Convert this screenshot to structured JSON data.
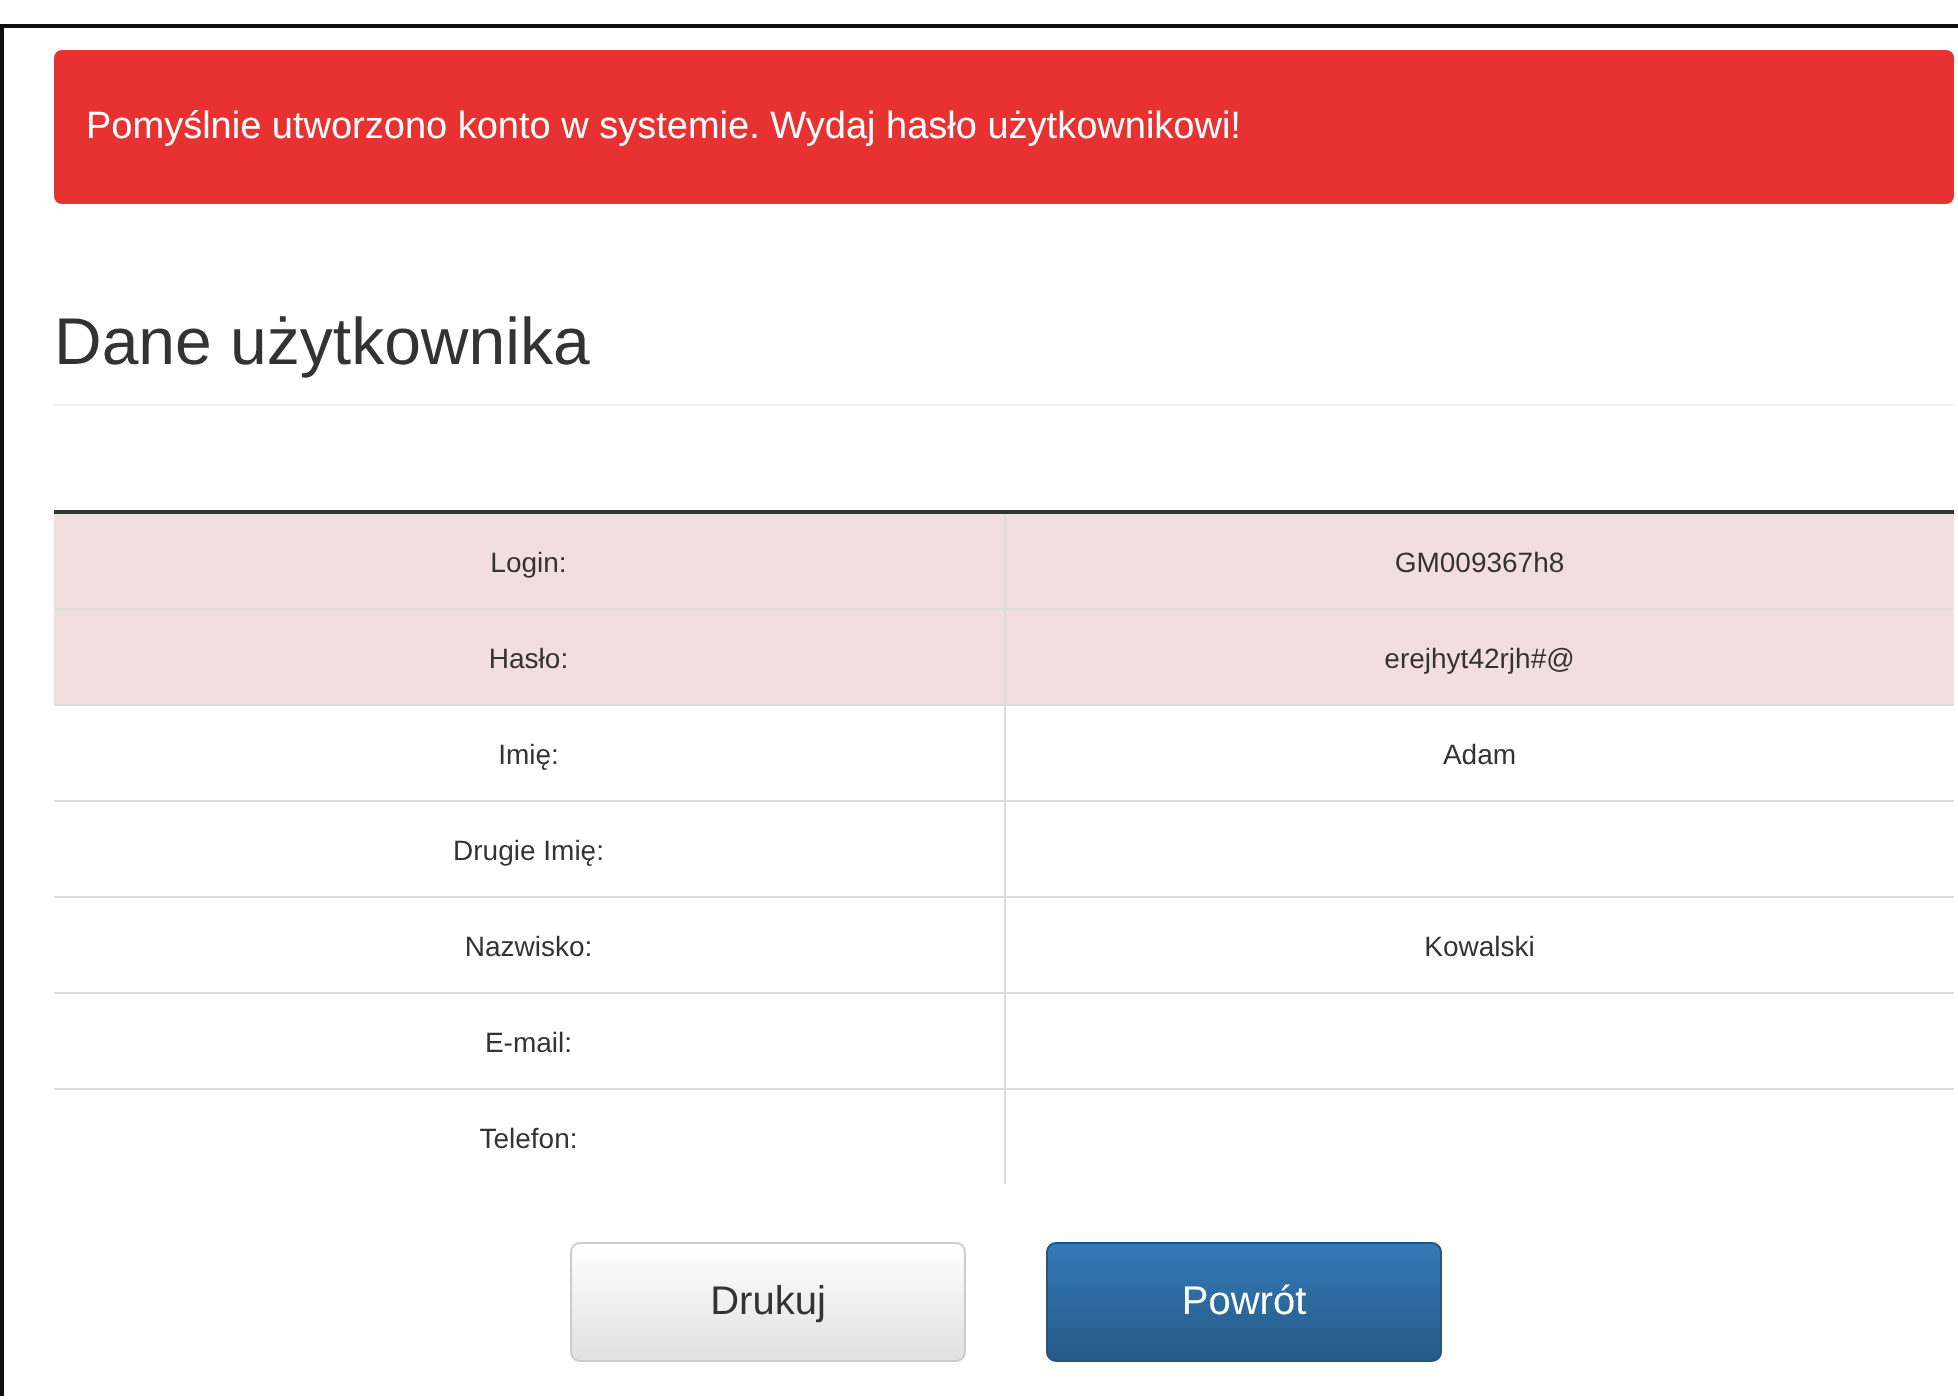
{
  "alert": {
    "text": "Pomyślnie utworzono konto w systemie. Wydaj hasło użytkownikowi!"
  },
  "heading": "Dane użytkownika",
  "table": {
    "rows": [
      {
        "label": "Login:",
        "value": "GM009367h8",
        "highlighted": true
      },
      {
        "label": "Hasło:",
        "value": "erejhyt42rjh#@",
        "highlighted": true
      },
      {
        "label": "Imię:",
        "value": "Adam",
        "highlighted": false
      },
      {
        "label": "Drugie Imię:",
        "value": "",
        "highlighted": false
      },
      {
        "label": "Nazwisko:",
        "value": "Kowalski",
        "highlighted": false
      },
      {
        "label": "E-mail:",
        "value": "",
        "highlighted": false
      },
      {
        "label": "Telefon:",
        "value": "",
        "highlighted": false
      }
    ]
  },
  "buttons": [
    {
      "label": "Drukuj",
      "kind": "default"
    },
    {
      "label": "Powrót",
      "kind": "primary"
    }
  ]
}
